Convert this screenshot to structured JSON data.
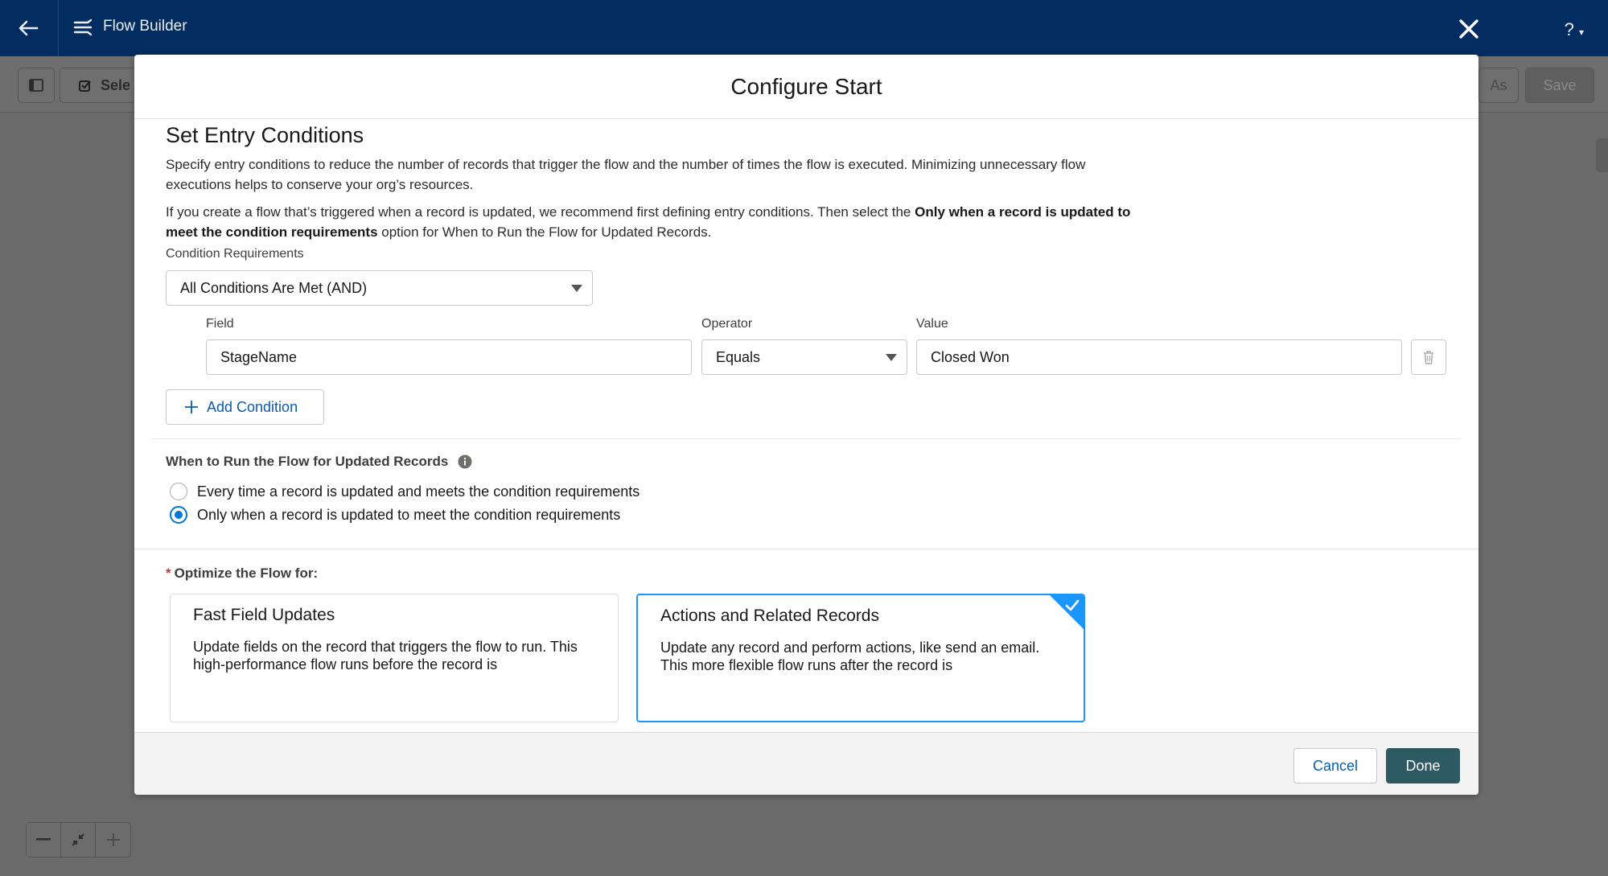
{
  "topbar": {
    "app_title": "Flow Builder",
    "help_label": "?"
  },
  "toolbar": {
    "select_label": "Sele",
    "save_as_label": "As",
    "save_label": "Save"
  },
  "modal": {
    "title": "Configure Start",
    "section_title": "Set Entry Conditions",
    "description_1": "Specify entry conditions to reduce the number of records that trigger the flow and the number of times the flow is executed. Minimizing unnecessary flow executions helps to conserve your org’s resources.",
    "description_2_pre": "If you create a flow that’s triggered when a record is updated, we recommend first defining entry conditions. Then select the ",
    "description_2_bold": "Only when a record is updated to meet the condition requirements",
    "description_2_post": " option for When to Run the Flow for Updated Records.",
    "condition_requirements": {
      "label": "Condition Requirements",
      "value": "All Conditions Are Met (AND)"
    },
    "condition": {
      "field_label": "Field",
      "field_value": "StageName",
      "operator_label": "Operator",
      "operator_value": "Equals",
      "value_label": "Value",
      "value_value": "Closed Won"
    },
    "add_condition_label": "Add Condition",
    "when_to_run": {
      "label": "When to Run the Flow for Updated Records",
      "options": [
        "Every time a record is updated and meets the condition requirements",
        "Only when a record is updated to meet the condition requirements"
      ],
      "selected_index": 1
    },
    "optimize": {
      "required_mark": "*",
      "label": "Optimize the Flow for:",
      "cards": [
        {
          "title": "Fast Field Updates",
          "description": "Update fields on the record that triggers the flow to run. This high-performance flow runs before the record is"
        },
        {
          "title": "Actions and Related Records",
          "description": "Update any record and perform actions, like send an email. This more flexible flow runs after the record is"
        }
      ]
    },
    "footer": {
      "cancel_label": "Cancel",
      "done_label": "Done"
    }
  },
  "colors": {
    "topbar": "#032d60",
    "brand_blue": "#0176d3",
    "selected_card": "#1b96ff",
    "done_button": "#2e5b63"
  }
}
